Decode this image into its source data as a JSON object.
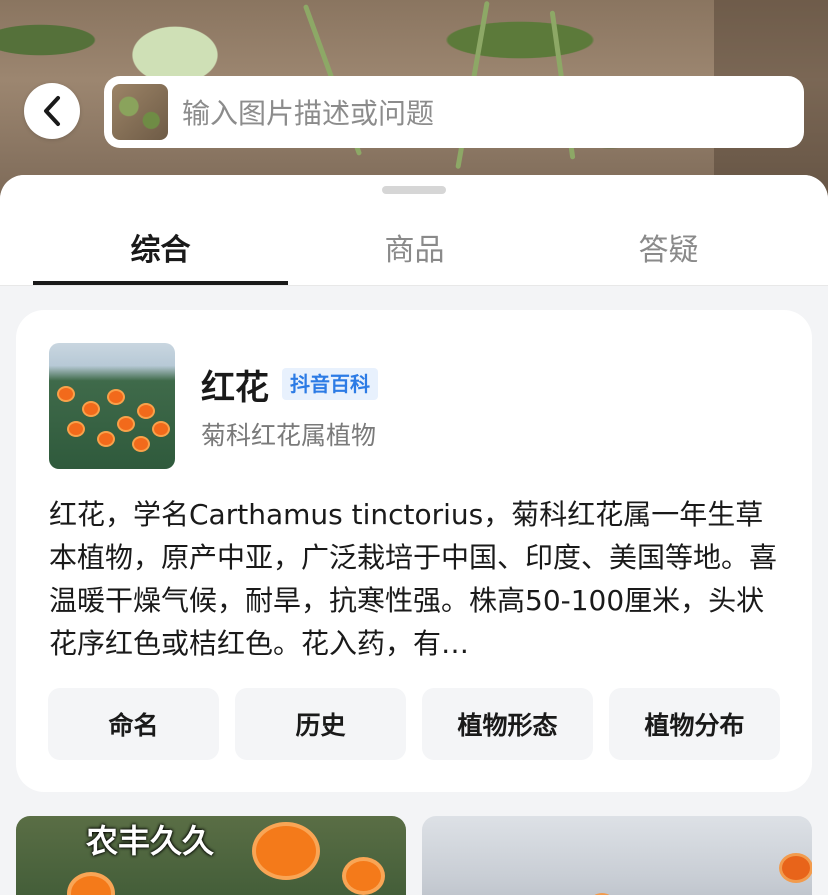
{
  "search": {
    "placeholder": "输入图片描述或问题"
  },
  "tabs": [
    {
      "label": "综合",
      "active": true
    },
    {
      "label": "商品",
      "active": false
    },
    {
      "label": "答疑",
      "active": false
    }
  ],
  "card": {
    "title": "红花",
    "badge": "抖音百科",
    "subtitle": "菊科红花属植物",
    "description": "红花，学名Carthamus tinctorius，菊科红花属一年生草本植物，原产中亚，广泛栽培于中国、印度、美国等地。喜温暖干燥气候，耐旱，抗寒性强。株高50-100厘米，头状花序红色或桔红色。花入药，有…",
    "chips": [
      "命名",
      "历史",
      "植物形态",
      "植物分布"
    ]
  },
  "results": [
    {
      "caption": "农丰久久"
    },
    {
      "caption": ""
    }
  ],
  "colors": {
    "accent": "#2c7be5",
    "badge_bg": "#e8f1fd",
    "flower": "#f26a1b"
  },
  "icons": {
    "back": "chevron-left-icon"
  }
}
